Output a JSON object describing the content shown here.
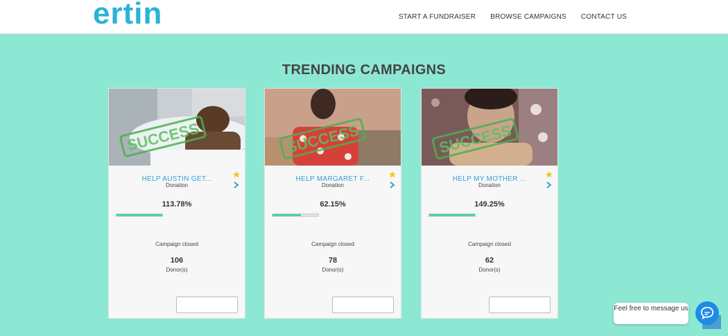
{
  "header": {
    "logo_text": "ertin",
    "nav": [
      "START A FUNDRAISER",
      "BROWSE CAMPAIGNS",
      "CONTACT US"
    ]
  },
  "main": {
    "section_title": "TRENDING CAMPAIGNS",
    "campaigns": [
      {
        "title": "HELP AUSTIN GET...",
        "type": "Donation",
        "percent": "113.78%",
        "progress": 1.0,
        "status": "Campaign closed",
        "donor_count": "106",
        "donor_label": "Donor(s)",
        "stamp": "SUCCESS"
      },
      {
        "title": "HELP MARGARET F...",
        "type": "Donation",
        "percent": "62.15%",
        "progress": 0.6215,
        "status": "Campaign closed",
        "donor_count": "78",
        "donor_label": "Donor(s)",
        "stamp": "SUCCESS"
      },
      {
        "title": "HELP MY MOTHER ...",
        "type": "Donation",
        "percent": "149.25%",
        "progress": 1.0,
        "status": "Campaign closed",
        "donor_count": "62",
        "donor_label": "Donor(s)",
        "stamp": "SUCCESS"
      }
    ]
  },
  "chat": {
    "message": "Feel free to message us"
  },
  "colors": {
    "background": "#8de8d3",
    "accent": "#2f9fd6",
    "progress": "#4fd1a7",
    "star": "#f5c518"
  },
  "icons": {
    "favorite": "star-icon",
    "more": "chevron-right-icon",
    "chat": "chat-icon"
  }
}
